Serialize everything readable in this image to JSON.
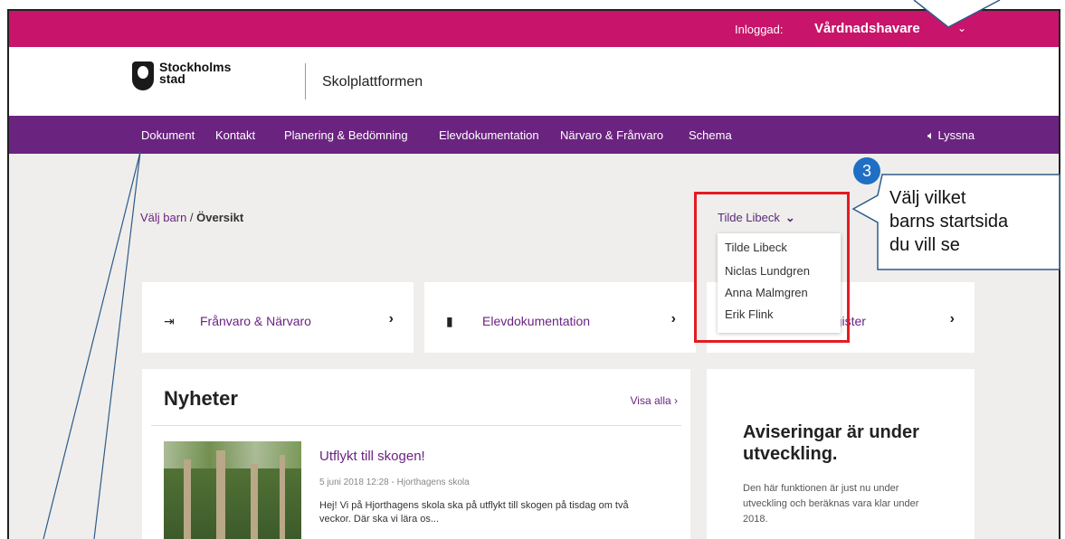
{
  "topbar": {
    "logged_in_label": "Inloggad:",
    "role": "Vårdnadshavare",
    "chevron": "⌄"
  },
  "header": {
    "logo_line1": "Stockholms",
    "logo_line2": "stad",
    "platform": "Skolplattformen"
  },
  "nav": {
    "items": [
      "Dokument",
      "Kontakt",
      "Planering & Bedömning",
      "Elevdokumentation",
      "Närvaro & Frånvaro",
      "Schema"
    ],
    "listen_icon": "speaker-icon",
    "listen": "Lyssna"
  },
  "breadcrumb": {
    "link": "Välj barn",
    "sep": " / ",
    "current": "Översikt"
  },
  "child_select": {
    "selected": "Tilde Libeck",
    "options": [
      "Tilde Libeck",
      "Niclas Lundgren",
      "Anna Malmgren",
      "Erik Flink"
    ]
  },
  "cards": [
    {
      "icon": "exit-icon",
      "title": "Frånvaro & Närvaro",
      "arrow": "›"
    },
    {
      "icon": "book-icon",
      "title": "Elevdokumentation",
      "arrow": "›"
    },
    {
      "icon": "",
      "title": "...gister",
      "arrow": "›"
    }
  ],
  "news": {
    "heading": "Nyheter",
    "show_all": "Visa alla ›",
    "item": {
      "title": "Utflykt till skogen!",
      "meta": "5 juni 2018 12:28 - Hjorthagens skola",
      "body": "Hej! Vi på Hjorthagens skola ska på utflykt till skogen på tisdag om två veckor. Där ska vi lära os..."
    }
  },
  "notice": {
    "heading": "Aviseringar är under utveckling.",
    "text": "Den här funktionen är just nu under utveckling och beräknas vara klar under 2018."
  },
  "callout": {
    "number": "3",
    "text_lines": [
      "Välj vilket",
      "barns startsida",
      "du vill se"
    ],
    "badge_color": "#1f6fc4",
    "highlight_color": "#e31b23"
  },
  "colors": {
    "topbar": "#c8146b",
    "nav": "#6b2380",
    "background": "#efeeec"
  }
}
